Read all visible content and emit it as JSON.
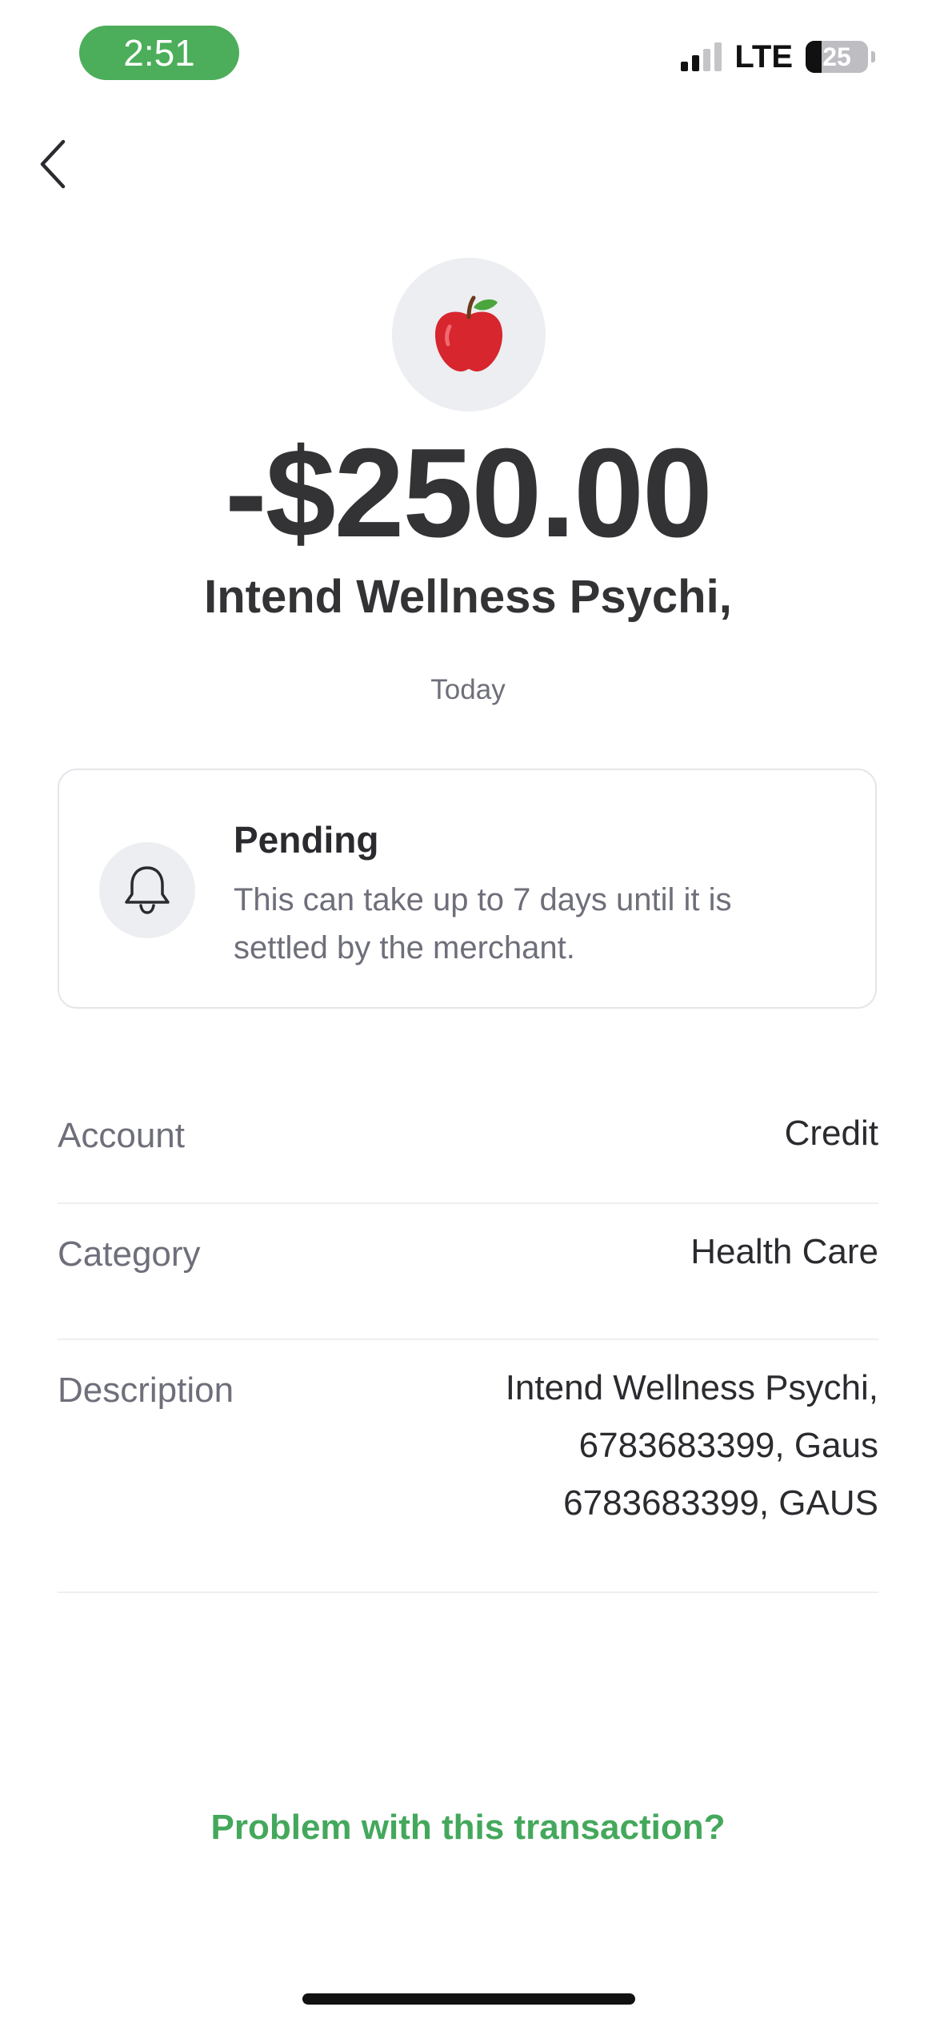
{
  "status_bar": {
    "time": "2:51",
    "network": "LTE",
    "battery": "25",
    "battery_level": 0.25
  },
  "navigation": {
    "back_icon": "chevron-left-icon"
  },
  "transaction": {
    "merchant_icon": "apple-icon",
    "amount": "-$250.00",
    "merchant_name": "Intend Wellness Psychi,",
    "date": "Today"
  },
  "pending": {
    "icon": "bell-icon",
    "title": "Pending",
    "message": "This can take up to 7 days until it is settled by the merchant."
  },
  "details": {
    "account": {
      "label": "Account",
      "value": "Credit"
    },
    "category": {
      "label": "Category",
      "value": "Health Care"
    },
    "description": {
      "label": "Description",
      "lines": [
        "Intend Wellness Psychi,",
        "6783683399, Gaus",
        "6783683399, GAUS"
      ]
    }
  },
  "actions": {
    "problem_link": "Problem with this transaction?"
  },
  "colors": {
    "accent_green": "#44a85c",
    "time_pill": "#4cae5a",
    "apple_red": "#d7262e"
  }
}
